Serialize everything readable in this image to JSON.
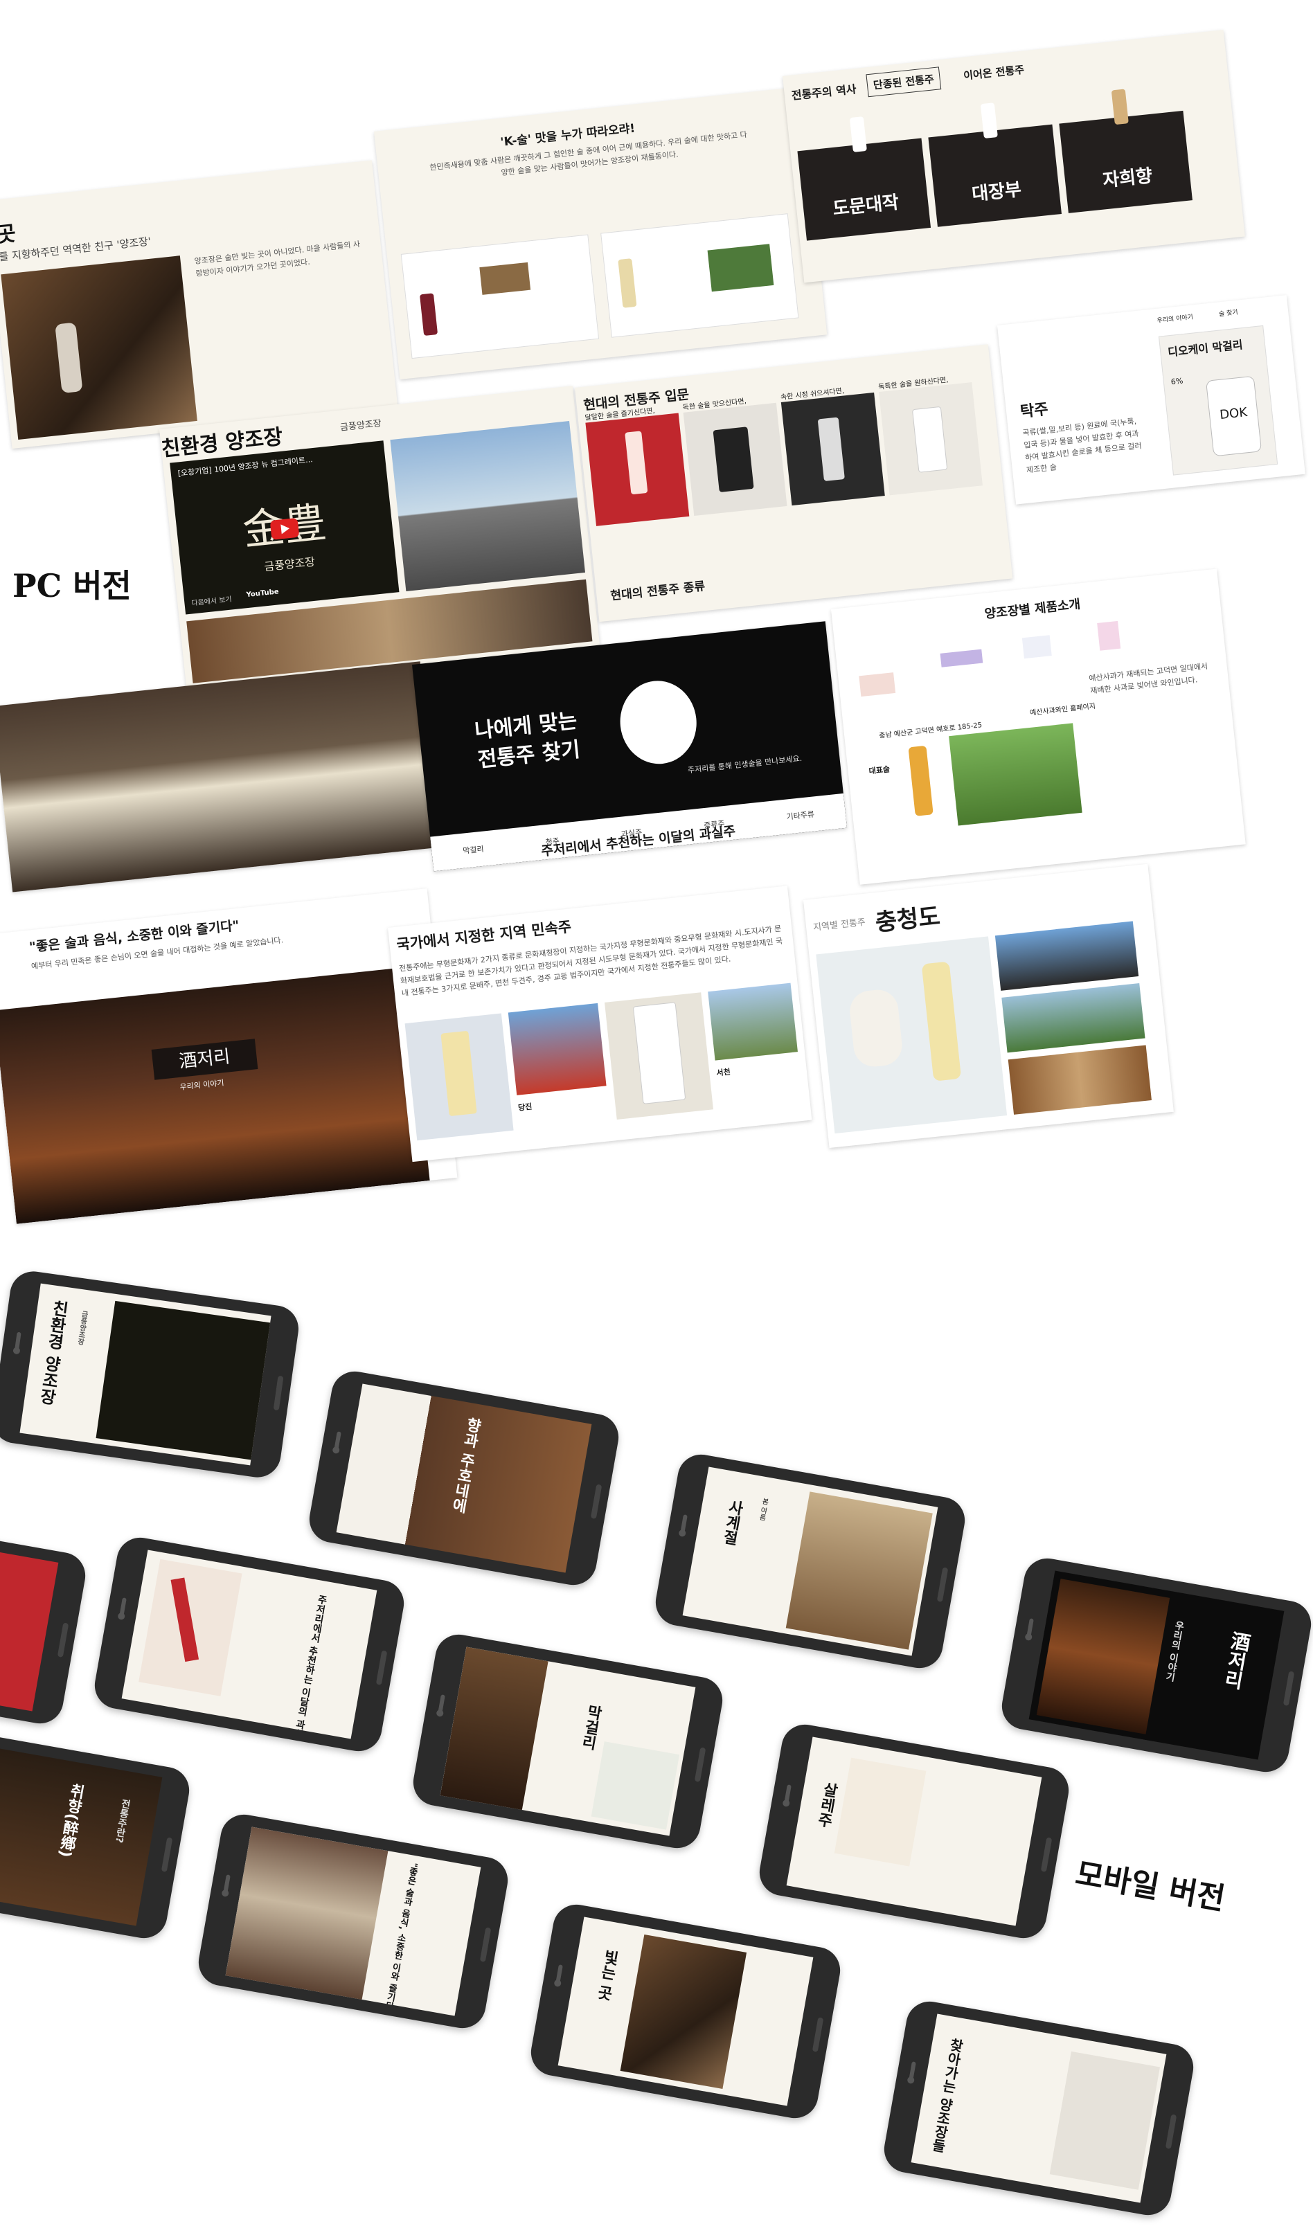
{
  "pc": {
    "label": "PC 버전",
    "k_sul": {
      "title": "'K-술' 맛을 누가 따라오랴!",
      "body": "한민족새용에 맞춤 사람은 깨끗하게 그 힘인한 술 중에 이어 근에 때용하다. 우리 술에 대한 맛하고 다양한 술을 맞는 사람들이 맛어가는 양조장이 재들동이다."
    },
    "history": {
      "title": "전통주의 역사",
      "tab_active": "단종된 전통주",
      "tab_2": "이어온 전통주",
      "cards": [
        "도문대작",
        "대장부",
        "자희향"
      ]
    },
    "friend": {
      "title": "곳",
      "subtitle": "를 지향하주던 역역한 친구 '양조장'"
    },
    "eco": {
      "title": "친환경 양조장",
      "subtitle": "금풍양조장",
      "video_title": "[오창기업] 100년 양조장 뉴 컴그레이트...",
      "video_logo": "金豊",
      "video_logo_sub": "금풍양조장",
      "watch": "다음에서 보기",
      "youtube": "YouTube"
    },
    "modern": {
      "title": "현대의 전통주 입문",
      "captions": [
        "달달한 술을 즐기신다면,",
        "독한 술을 맛으신다면,",
        "속한 시정 쉬으셔다면,",
        "독특한 술을 원하신다면,"
      ],
      "kinds_title": "현대의 전통주 종류"
    },
    "takju": {
      "title": "탁주",
      "body": "곡류(쌀,밀,보리 등) 원료에 국(누룩, 입국 등)과 물을 넣어 발효한 후 여과하여 발효시킨 술로을 체 등으로 걸러 제조한 술"
    },
    "dok": {
      "card_title": "디오케이 막걸리",
      "percent": "6%",
      "brand": "DOK",
      "links": [
        "우리의 이야기",
        "술 찾기"
      ]
    },
    "find": {
      "title_1": "나에게 맞는",
      "title_2": "전통주 찾기",
      "sub": "주저리를 통해 인생술을 만나보세요.",
      "tabs": [
        "막걸리",
        "청주",
        "과실주",
        "증류주",
        "기타주류"
      ]
    },
    "brewery": {
      "title": "양조장별 제품소개",
      "rep": "대표술",
      "addr": "충남 예산군 고덕면 예호로 185-25",
      "site": "예산사과와인 홈페이지"
    },
    "recommend": {
      "title": "주저리에서 추천하는 이달의 과실주"
    },
    "good": {
      "title": "\"좋은 술과 음식, 소중한 이와 즐기다\"",
      "body": "예부터 우리 민족은 좋은 손님이 오면 술을 내어 대접하는 것을 예로 알았습니다."
    },
    "hero": {
      "sign": "酒저리",
      "sign_sub": "우리의 이야기"
    },
    "folk": {
      "title": "국가에서 지정한 지역 민속주",
      "body": "전통주에는 무형문화재가 2가지 종류로 문화재청장이 지정하는 국가지정 무형문화재와 중요무형 문화재와 시.도지사가 문화재보호법을 근거로 한 보존가치가 있다고 판정되어서 지정된 시도무형 문화재가 있다. 국가에서 지정한 무형문화재인 국내 전통주는 3가지로 문배주, 면천 두견주, 경주 교동 법주이지만 국가에서 지정한 전통주들도 많이 있다.",
      "cap_1": "당진",
      "cap_2": "서천"
    },
    "region": {
      "label": "지역별 전통주",
      "title": "충청도"
    }
  },
  "mobile": {
    "label": "모바일 버전",
    "phones": {
      "p1": "친환경 양조장",
      "p1_sub": "금풍양조장",
      "p2": "향과 주호네에",
      "p3": "사계절",
      "p3_tabs": [
        "봄",
        "여름",
        "가을",
        "겨울"
      ],
      "p4": "酒저리",
      "p4_sub": "우리의 이야기",
      "p5": "주저리에서 추천하는 이달의 과실주",
      "p6": "막걸리",
      "p7": "살레주",
      "p8": "취향(醉鄕)",
      "p8_sub": "전통주란?",
      "p9": "\"좋은 술과 음식, 소중한 이와 즐기다\"",
      "p10": "빛는 곳",
      "p11": "찾아가는 양조장들"
    }
  },
  "colors": {
    "paper": "#f7f4ec",
    "dark": "#0c0c0c",
    "card": "#231f1e",
    "phone": "#2b2b2b"
  }
}
